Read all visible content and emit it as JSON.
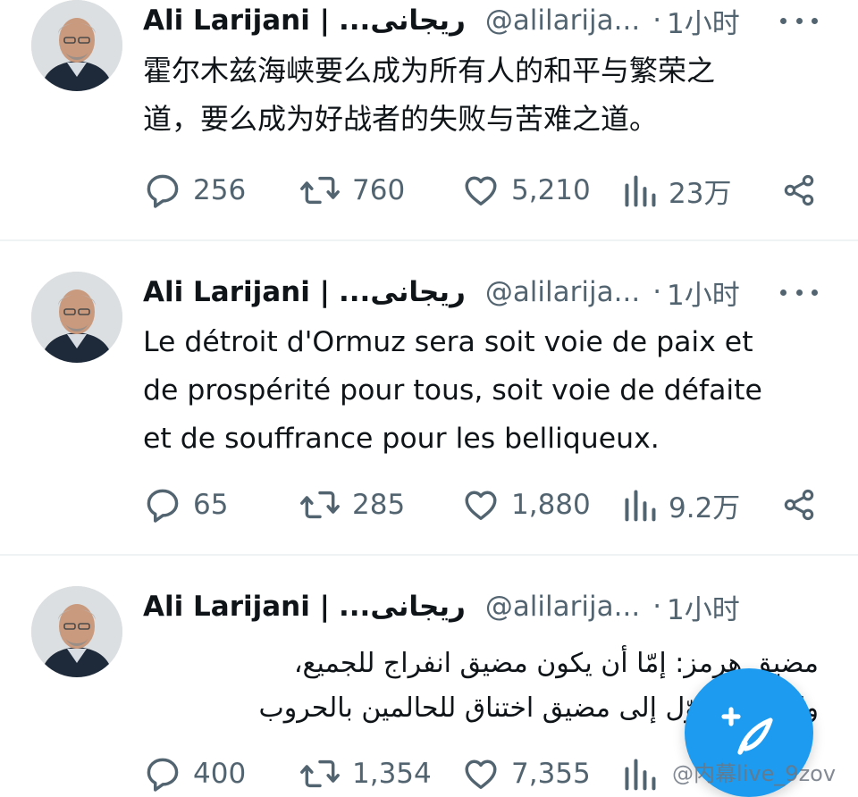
{
  "tweets": [
    {
      "author": {
        "name": "Ali Larijani |",
        "name_rtl": "...ريجانى",
        "handle": "@alilarija...",
        "sep": "·",
        "time": "1小时"
      },
      "text": "霍尔木兹海峡要么成为所有人的和平与繁荣之\n道，要么成为好战者的失败与苦难之道。",
      "stats": {
        "replies": "256",
        "reposts": "760",
        "likes": "5,210",
        "views": "23万"
      }
    },
    {
      "author": {
        "name": "Ali Larijani |",
        "name_rtl": "...ريجانى",
        "handle": "@alilarija...",
        "sep": "·",
        "time": "1小时"
      },
      "text": "Le détroit d'Ormuz sera soit voie de paix et\nde prospérité pour tous, soit voie de défaite\net de souffrance pour les belliqueux.",
      "stats": {
        "replies": "65",
        "reposts": "285",
        "likes": "1,880",
        "views": "9.2万"
      }
    },
    {
      "author": {
        "name": "Ali Larijani |",
        "name_rtl": "...ريجانى",
        "handle": "@alilarija...",
        "sep": "·",
        "time": "1小时"
      },
      "text": "مضيق هرمز: إمّا أن يكون مضيق انفراج للجميع،\nوإمّا أن يتحوّل إلى مضيق اختناق للحالمين بالحروب",
      "stats": {
        "replies": "400",
        "reposts": "1,354",
        "likes": "7,355",
        "views": ""
      }
    }
  ],
  "watermark": "@内幕live_9zov",
  "colors": {
    "text": "#0f1419",
    "secondary": "#536471",
    "accent": "#1d9bf0",
    "divider": "#eff3f4"
  },
  "icons": [
    "reply-icon",
    "repost-icon",
    "like-icon",
    "views-icon",
    "share-icon",
    "more-icon",
    "compose-icon"
  ]
}
